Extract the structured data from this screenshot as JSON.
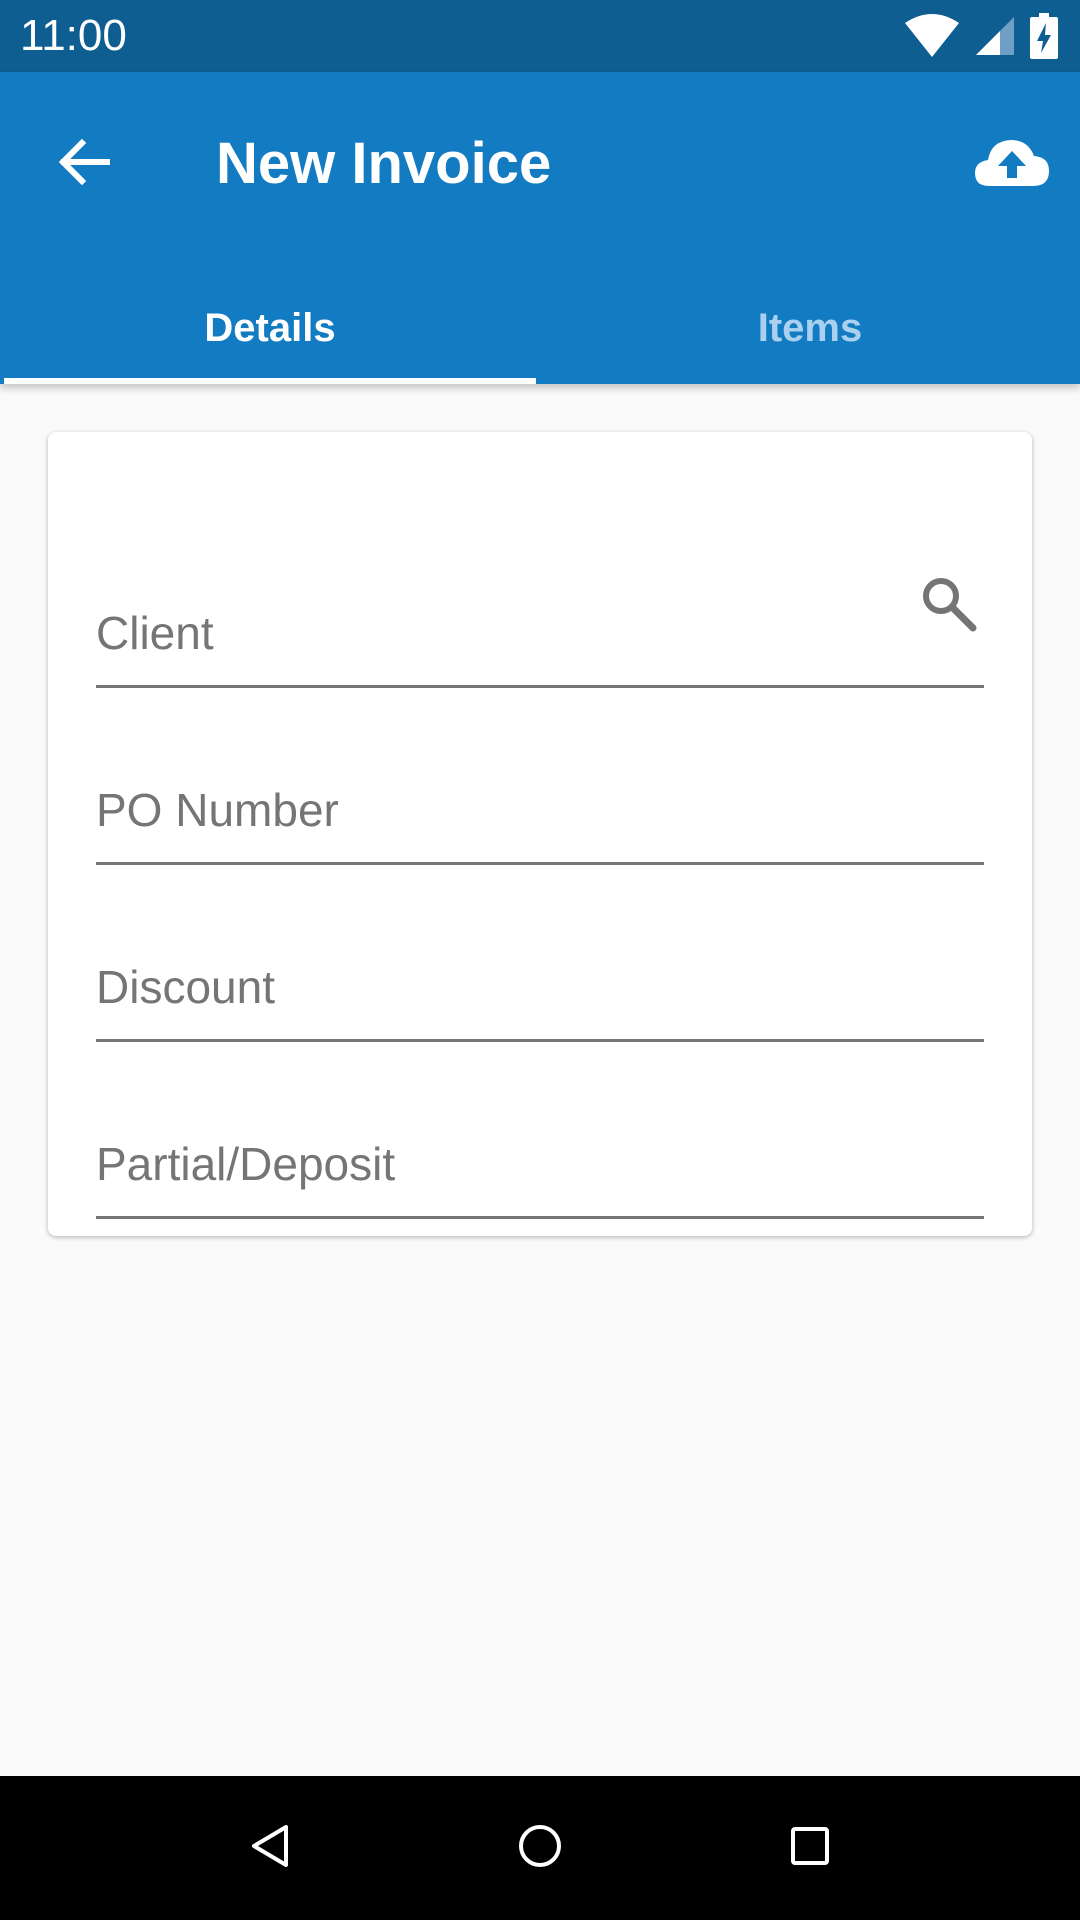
{
  "status_bar": {
    "time": "11:00",
    "icons": [
      "wifi-icon",
      "cell-signal-icon",
      "battery-charging-icon"
    ]
  },
  "app_bar": {
    "title": "New Invoice",
    "back_icon": "arrow-back-icon",
    "action_icon": "cloud-upload-icon",
    "color": "#137bc1"
  },
  "tabs": [
    {
      "label": "Details",
      "active": true
    },
    {
      "label": "Items",
      "active": false
    }
  ],
  "form": {
    "fields": [
      {
        "placeholder": "Client",
        "value": "",
        "icon": "search-icon"
      },
      {
        "placeholder": "PO Number",
        "value": ""
      },
      {
        "placeholder": "Discount",
        "value": ""
      },
      {
        "placeholder": "Partial/Deposit",
        "value": ""
      }
    ]
  },
  "nav_bar": {
    "icons": [
      "back-triangle-icon",
      "home-circle-icon",
      "recents-square-icon"
    ]
  }
}
